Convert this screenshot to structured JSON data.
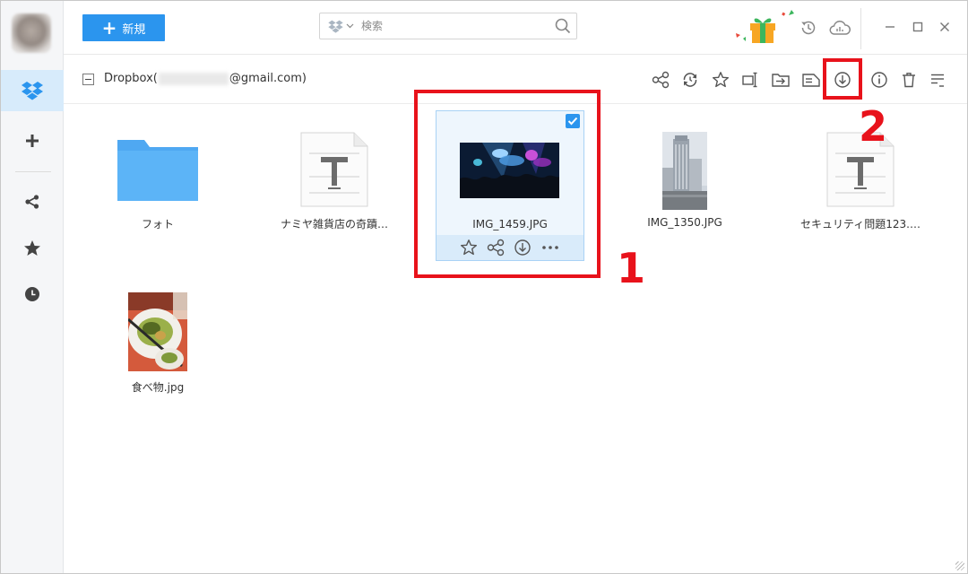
{
  "toolbar": {
    "new_label": "新規",
    "search_placeholder": "検索"
  },
  "path": {
    "prefix": "Dropbox(",
    "suffix": "@gmail.com)"
  },
  "files": [
    {
      "name": "フォト",
      "type": "folder"
    },
    {
      "name": "ナミヤ雑貨店の奇蹟…",
      "type": "text"
    },
    {
      "name": "IMG_1459.JPG",
      "type": "image",
      "selected": true
    },
    {
      "name": "IMG_1350.JPG",
      "type": "image"
    },
    {
      "name": "セキュリティ問題123.…",
      "type": "text"
    },
    {
      "name": "食べ物.jpg",
      "type": "image"
    }
  ],
  "annotations": {
    "label1": "1",
    "label2": "2"
  },
  "colors": {
    "accent": "#2b95ee",
    "highlight": "#e8121b",
    "folder": "#4fa8f2"
  },
  "icons": {
    "sidebar": [
      "avatar",
      "dropbox-icon",
      "plus-icon",
      "share-icon",
      "star-icon",
      "clock-icon"
    ],
    "top": [
      "gift-icon",
      "history-icon",
      "cloud-icon",
      "minimize-icon",
      "maximize-icon",
      "close-icon"
    ],
    "path_actions": [
      "share-icon",
      "sync-icon",
      "star-icon",
      "rename-icon",
      "move-icon",
      "copy-icon",
      "download-icon",
      "info-icon",
      "trash-icon",
      "sort-icon"
    ]
  }
}
